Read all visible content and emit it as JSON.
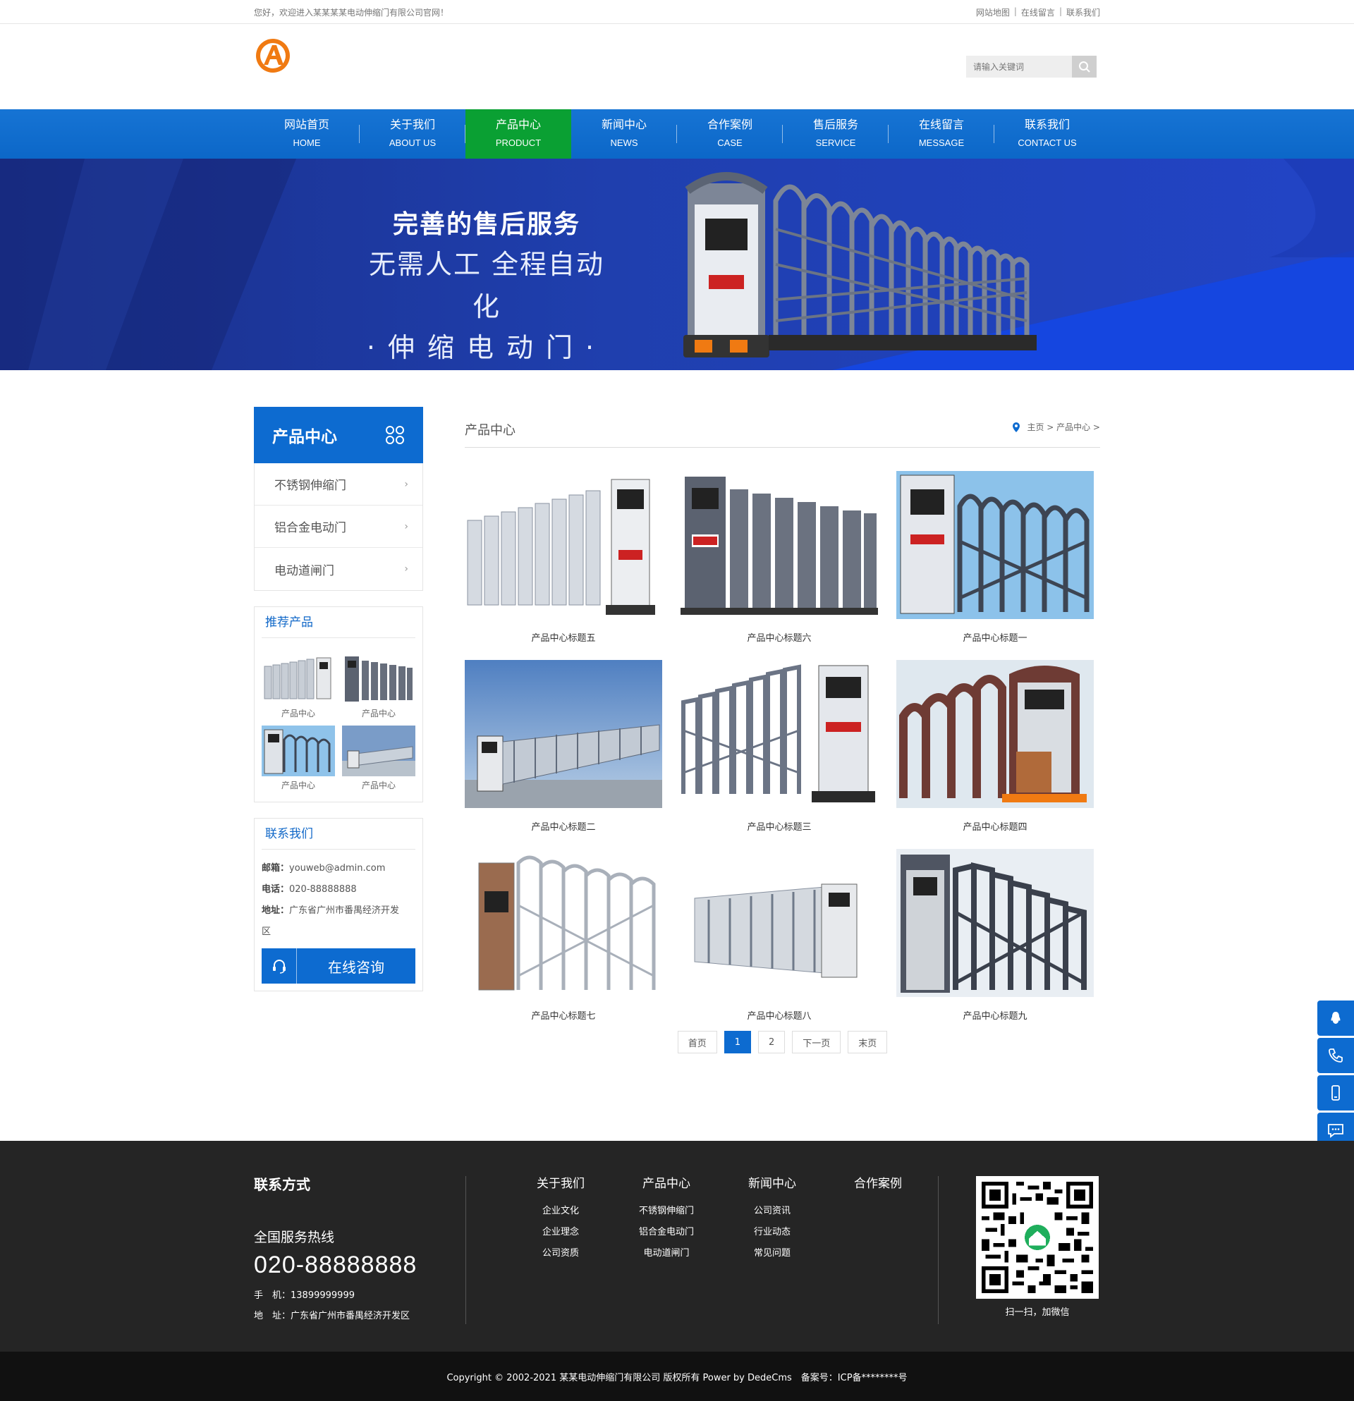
{
  "topbar": {
    "welcome": "您好，欢迎进入某某某某电动伸缩门有限公司官网！",
    "links": [
      "网站地图",
      "在线留言",
      "联系我们"
    ]
  },
  "search": {
    "placeholder": "请输入关键词"
  },
  "nav": [
    {
      "cn": "网站首页",
      "en": "HOME"
    },
    {
      "cn": "关于我们",
      "en": "ABOUT US"
    },
    {
      "cn": "产品中心",
      "en": "PRODUCT"
    },
    {
      "cn": "新闻中心",
      "en": "NEWS"
    },
    {
      "cn": "合作案例",
      "en": "CASE"
    },
    {
      "cn": "售后服务",
      "en": "SERVICE"
    },
    {
      "cn": "在线留言",
      "en": "MESSAGE"
    },
    {
      "cn": "联系我们",
      "en": "CONTACT US"
    }
  ],
  "nav_active_index": 2,
  "banner": {
    "line1": "完善的售后服务",
    "line2": "无需人工 全程自动化",
    "line3": "·伸缩电动门·"
  },
  "sidebar": {
    "title": "产品中心",
    "categories": [
      "不锈钢伸缩门",
      "铝合金电动门",
      "电动道闸门"
    ],
    "recommend_title": "推荐产品",
    "recommend": [
      "产品中心",
      "产品中心",
      "产品中心",
      "产品中心"
    ],
    "contact_title": "联系我们",
    "email_label": "邮箱：",
    "email": "youweb@admin.com",
    "phone_label": "电话：",
    "phone": "020-88888888",
    "address_label": "地址：",
    "address_1": "广东省广州市番禺经济开发",
    "address_2": "区",
    "consult": "在线咨询"
  },
  "content": {
    "title": "产品中心",
    "breadcrumb": "主页 > 产品中心 >"
  },
  "products": [
    "产品中心标题五",
    "产品中心标题六",
    "产品中心标题一",
    "产品中心标题二",
    "产品中心标题三",
    "产品中心标题四",
    "产品中心标题七",
    "产品中心标题八",
    "产品中心标题九"
  ],
  "pager": [
    "首页",
    "1",
    "2",
    "下一页",
    "末页"
  ],
  "pager_active_index": 1,
  "footer": {
    "contact_title": "联系方式",
    "hotline_label": "全国服务热线",
    "hotline": "020-88888888",
    "mobile": "手　机：13899999999",
    "address": "地　址：广东省广州市番禺经济开发区",
    "cols": [
      {
        "title": "关于我们",
        "items": [
          "企业文化",
          "企业理念",
          "公司资质"
        ]
      },
      {
        "title": "产品中心",
        "items": [
          "不锈钢伸缩门",
          "铝合金电动门",
          "电动道闸门"
        ]
      },
      {
        "title": "新闻中心",
        "items": [
          "公司资讯",
          "行业动态",
          "常见问题"
        ]
      },
      {
        "title": "合作案例",
        "items": []
      }
    ],
    "qr_label": "扫一扫，加微信"
  },
  "copyright": "Copyright © 2002-2021 某某电动伸缩门有限公司 版权所有 Power by DedeCms　备案号：ICP备********号",
  "colors": {
    "primary": "#0d6bd0",
    "active_nav": "#0aa033",
    "footer_bg": "#252525",
    "copyright_bg": "#111111"
  }
}
